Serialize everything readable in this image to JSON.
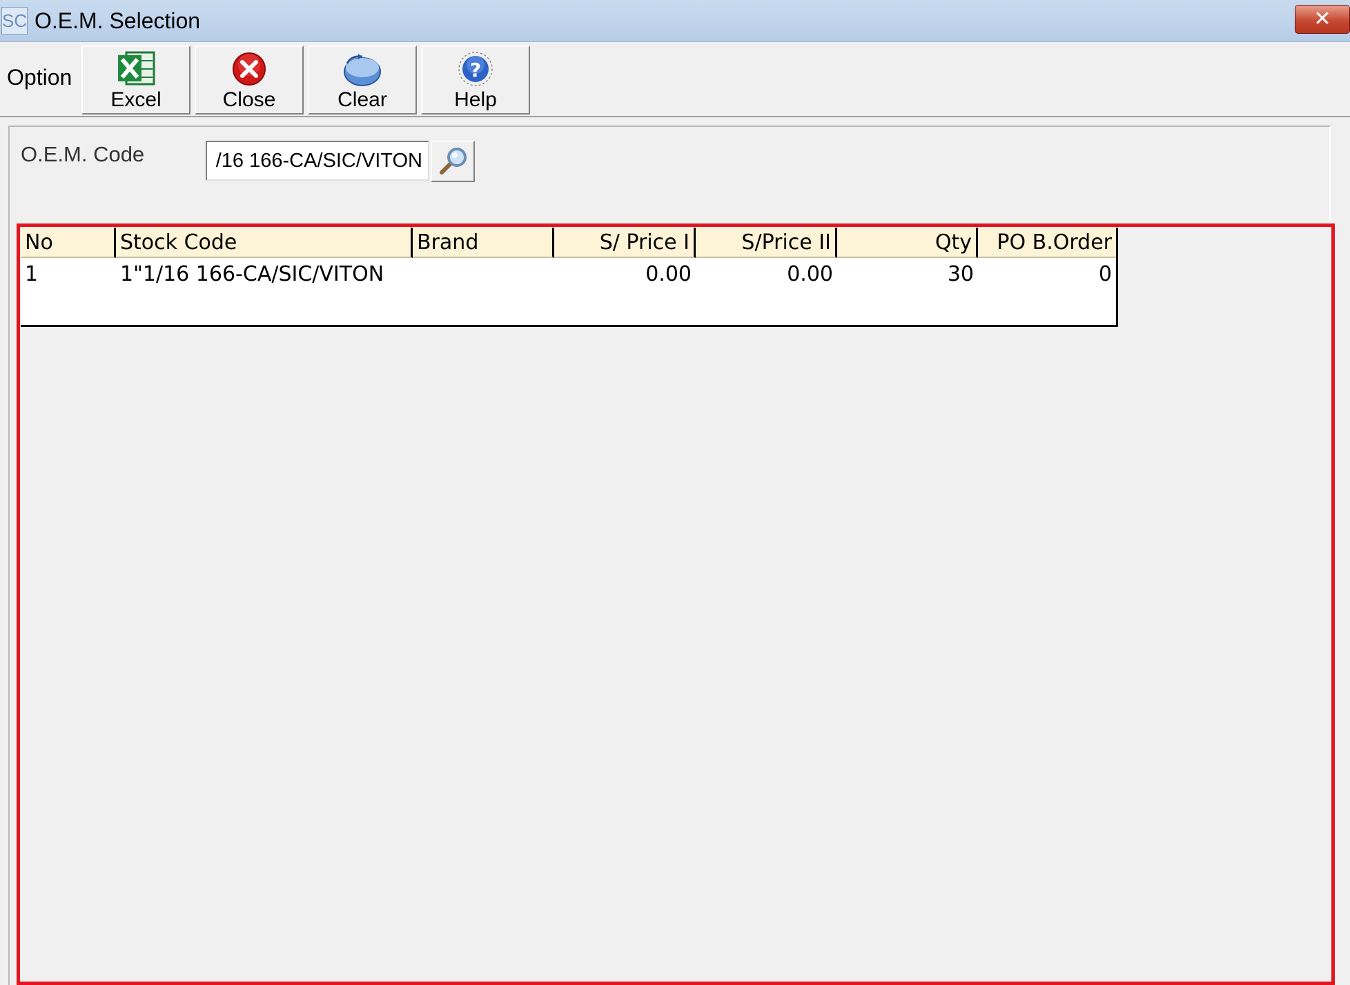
{
  "window": {
    "app_icon_text": "SC",
    "title": "O.E.M. Selection",
    "close_symbol": "✕"
  },
  "toolbar": {
    "option_label": "Option",
    "buttons": [
      {
        "label": "Excel",
        "icon": "excel-icon"
      },
      {
        "label": "Close",
        "icon": "close-red-icon"
      },
      {
        "label": "Clear",
        "icon": "clear-icon"
      },
      {
        "label": "Help",
        "icon": "help-icon"
      }
    ]
  },
  "search": {
    "label": "O.E.M. Code",
    "value": "/16 166-CA/SIC/VITON",
    "button_icon": "magnifier-icon"
  },
  "grid": {
    "columns": [
      "No",
      "Stock Code",
      "Brand",
      "S/ Price I",
      "S/Price II",
      "Qty",
      "PO B.Order"
    ],
    "rows": [
      {
        "no": "1",
        "stock_code": "1\"1/16 166-CA/SIC/VITON",
        "brand": "",
        "price1": "0.00",
        "price2": "0.00",
        "qty": "30",
        "po_border": "0"
      }
    ]
  },
  "colors": {
    "highlight_border": "#e3161f",
    "grid_header_bg": "#fdf3d6",
    "titlebar": "#c9dbef"
  }
}
